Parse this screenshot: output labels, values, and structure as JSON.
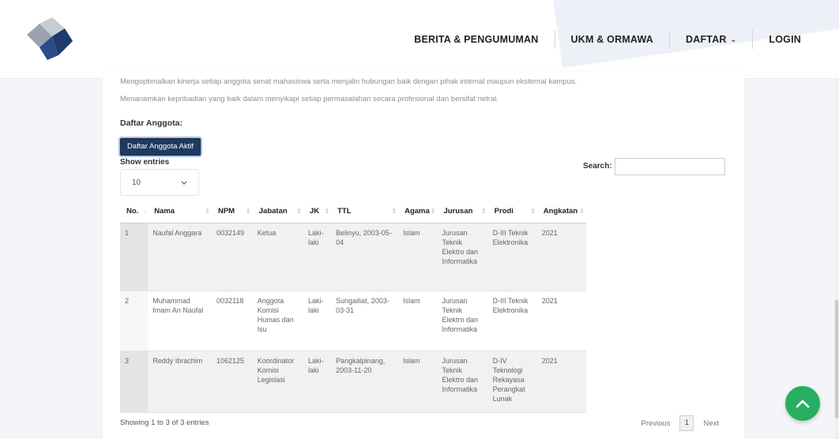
{
  "nav": {
    "items": [
      "BERITA & PENGUMUMAN",
      "UKM & ORMAWA",
      "DAFTAR",
      "LOGIN"
    ]
  },
  "content": {
    "paragraphs": [
      "Mengoptimalkan kinerja setiap anggota senat mahasiswa serta menjalin hubungan baik dengan pihak internal maupun eksternal kampus.",
      "Menanamkan kepribadian yang baik dalam menyikapi setiap permasalahan secara profesional dan bersifat netral."
    ],
    "section_label": "Daftar Anggota:",
    "active_button": "Daftar Anggota Aktif"
  },
  "table_controls": {
    "show_entries": "Show entries",
    "entries_value": "10",
    "search_label": "Search:",
    "search_value": ""
  },
  "table": {
    "headers": [
      "No.",
      "Nama",
      "NPM",
      "Jabatan",
      "JK",
      "TTL",
      "Agama",
      "Jurusan",
      "Prodi",
      "Angkatan"
    ],
    "rows": [
      [
        "1",
        "Naufal Anggara",
        "0032149",
        "Ketua",
        "Laki-laki",
        "Belinyu, 2003-05-04",
        "Islam",
        "Jurusan Teknik Elektro dan Informatika",
        "D-III Teknik Elektronika",
        "2021"
      ],
      [
        "2",
        "Muhammad Imam An Naufal",
        "0032118",
        "Anggota Komisi Humas dan Isu",
        "Laki-laki",
        "Sungailiat, 2003-03-31",
        "Islam",
        "Jurusan Teknik Elektro dan Informatika",
        "D-III Teknik Elektronika",
        "2021"
      ],
      [
        "3",
        "Reddy Ibrachim",
        "1062125",
        "Koordinator Komisi Legislasi",
        "Laki-laki",
        "Pangkalpinang, 2003-11-20",
        "Islam",
        "Jurusan Teknik Elektro dan Informatika",
        "D-IV Teknologi Rekayasa Perangkat Lunak",
        "2021"
      ]
    ]
  },
  "footer": {
    "info": "Showing 1 to 3 of 3 entries",
    "previous": "Previous",
    "current_page": "1",
    "next": "Next"
  },
  "colors": {
    "button_bg": "#1f3a5f",
    "fab_bg": "#27ae60"
  },
  "icons": [
    "logo-icon",
    "chevron-down-icon",
    "sort-icon",
    "arrow-up-icon"
  ]
}
